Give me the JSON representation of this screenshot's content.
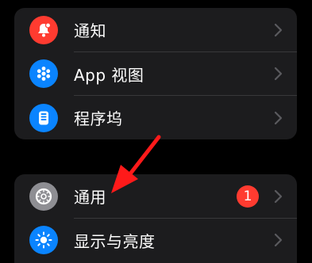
{
  "colors": {
    "notifications_icon_bg": "#ff3b30",
    "app_view_icon_bg": "#0a84ff",
    "dock_icon_bg": "#0a84ff",
    "general_icon_bg": "#8e8e93",
    "display_icon_bg": "#0a84ff",
    "badge_bg": "#ff3b30",
    "arrow_color": "#ff1a1a"
  },
  "group1": {
    "items": [
      {
        "label": "通知",
        "icon": "bell-badge-icon"
      },
      {
        "label": "App 视图",
        "icon": "app-grid-icon"
      },
      {
        "label": "程序坞",
        "icon": "dock-icon"
      }
    ]
  },
  "group2": {
    "items": [
      {
        "label": "通用",
        "icon": "gear-icon",
        "badge": "1"
      },
      {
        "label": "显示与亮度",
        "icon": "sun-icon"
      }
    ]
  },
  "annotation": {
    "type": "red-arrow",
    "points_to": "通用"
  }
}
